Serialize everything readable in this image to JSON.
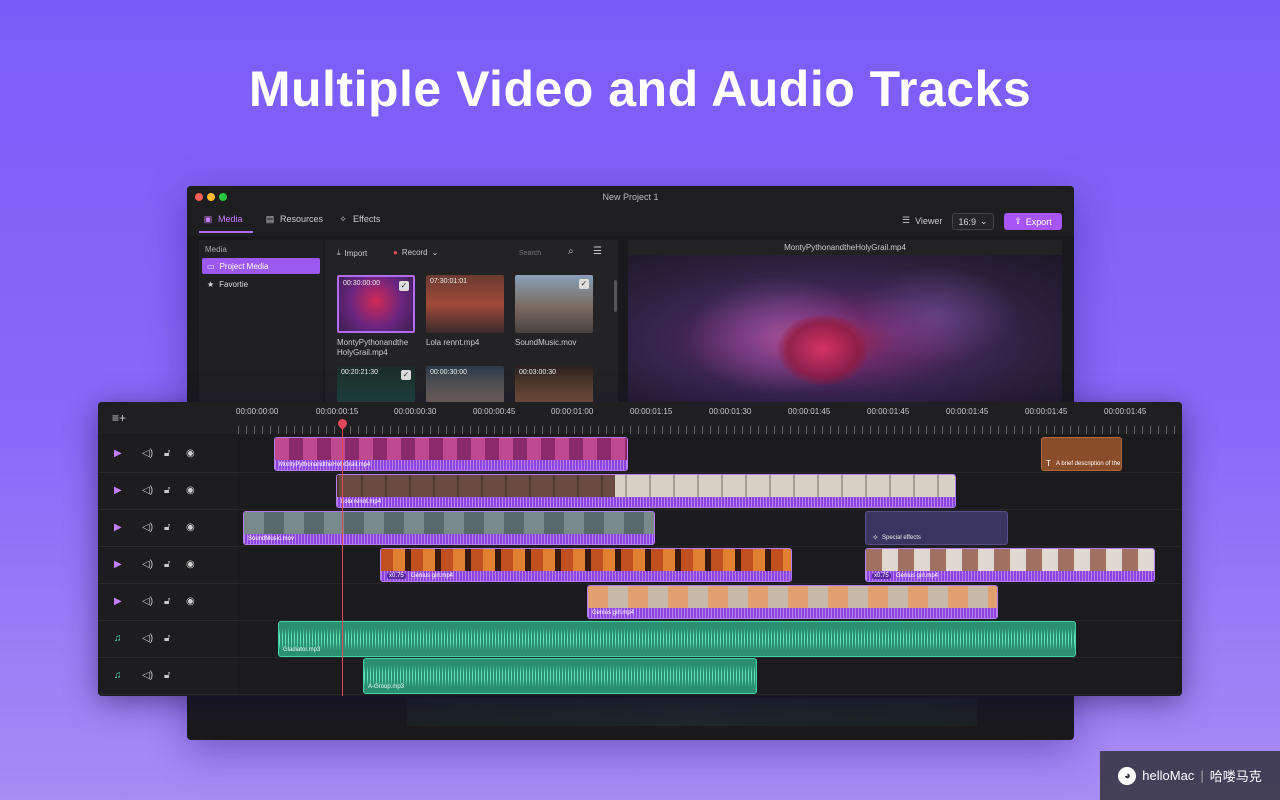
{
  "hero": {
    "title": "Multiple Video and Audio Tracks"
  },
  "window": {
    "title": "New Project 1"
  },
  "tabs": [
    {
      "label": "Media",
      "icon": "media-icon",
      "active": true
    },
    {
      "label": "Resources",
      "icon": "resources-icon",
      "active": false
    },
    {
      "label": "Effects",
      "icon": "effects-icon",
      "active": false
    }
  ],
  "toolbar": {
    "viewer_label": "Viewer",
    "ratio_label": "16:9",
    "export_label": "Export",
    "accent": "#a855f7"
  },
  "sidebar": {
    "heading": "Media",
    "items": [
      {
        "label": "Project Media",
        "icon": "folder-icon",
        "active": true
      },
      {
        "label": "Favortie",
        "icon": "star-icon",
        "active": false
      }
    ]
  },
  "media": {
    "import_label": "Import",
    "record_label": "Record",
    "search_placeholder": "Search",
    "items": [
      {
        "timecode": "00:30:00:00",
        "name": "MontyPythonandthe HolyGrail.mp4",
        "checked": true,
        "selected": true
      },
      {
        "timecode": "07:30:01:01",
        "name": "Lola rennt.mp4",
        "checked": false,
        "selected": false
      },
      {
        "timecode": "",
        "name": "SoundMusic.mov",
        "checked": true,
        "selected": false
      },
      {
        "timecode": "00:20:21:30",
        "name": "",
        "checked": true,
        "selected": false
      },
      {
        "timecode": "00:00:30:00",
        "name": "",
        "checked": false,
        "selected": false
      },
      {
        "timecode": "00:03:00:30",
        "name": "",
        "checked": false,
        "selected": false
      }
    ]
  },
  "preview": {
    "title": "MontyPythonandtheHolyGrail.mp4"
  },
  "timeline": {
    "ruler": [
      "00:00:00:00",
      "00:00:00:15",
      "00:00:00:30",
      "00:00:00:45",
      "00:00:01:00",
      "00:00:01:15",
      "00:00:01:30",
      "00:00:01:45",
      "00:00:01:45",
      "00:00:01:45",
      "00:00:01:45",
      "00:00:01:45"
    ],
    "tracks": [
      {
        "type": "video"
      },
      {
        "type": "video"
      },
      {
        "type": "video"
      },
      {
        "type": "video"
      },
      {
        "type": "video"
      },
      {
        "type": "audio"
      },
      {
        "type": "audio"
      }
    ],
    "clips": {
      "monty": "MontyPythonandtheHolyGrail.mp4",
      "lola": "Lola rennt.mp4",
      "sound": "SoundMusic.mov",
      "genius_a": "Genius girl.mp4",
      "genius_b": "Genius girl.mp4",
      "genius_c": "Genius girl.mp4",
      "gladiator": "Gladiator.mp3",
      "agroup": "A-Group.mp3",
      "speed_a": "x0.75",
      "speed_b": "x0.75",
      "text_desc": "A brief description of the",
      "fx": "Special effects"
    }
  },
  "watermark": {
    "brand": "helloMac",
    "sep": "|",
    "cn": "哈喽马克"
  }
}
